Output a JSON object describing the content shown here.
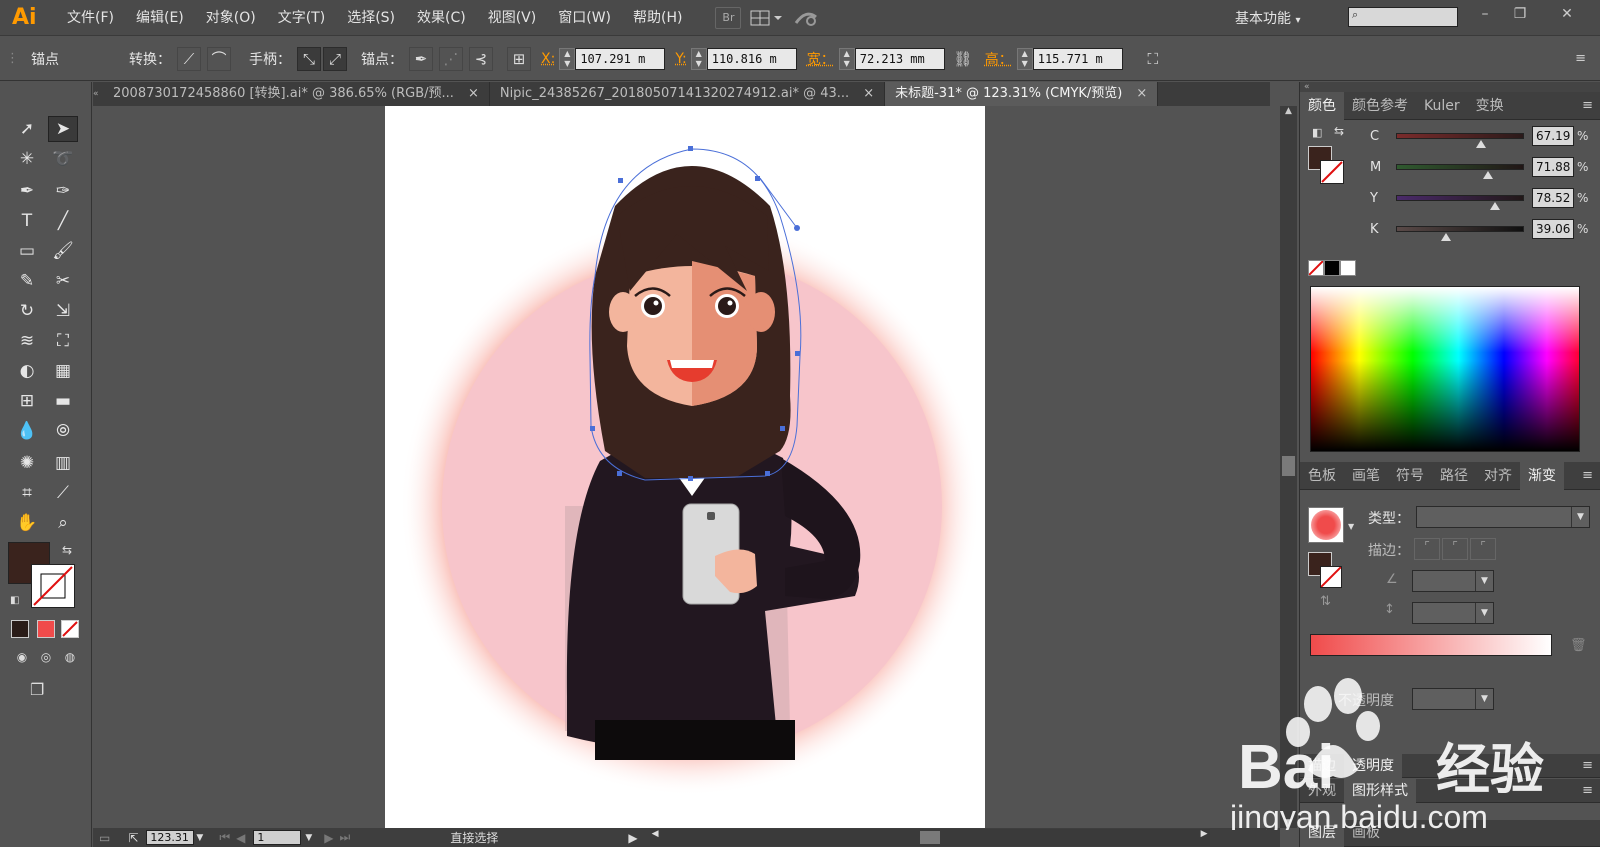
{
  "app": {
    "logo": "Ai"
  },
  "menu": [
    "文件(F)",
    "编辑(E)",
    "对象(O)",
    "文字(T)",
    "选择(S)",
    "效果(C)",
    "视图(V)",
    "窗口(W)",
    "帮助(H)"
  ],
  "appbar": {
    "bridge_label": "Br",
    "workspace": "基本功能",
    "workspace_arrow": "▾",
    "search_placeholder": ""
  },
  "control": {
    "tool_name": "锚点",
    "convert": "转换：",
    "handle": "手柄：",
    "anchor": "锚点：",
    "x_label": "X:",
    "x_value": "107.291 m",
    "y_label": "Y:",
    "y_value": "110.816 m",
    "w_label": "宽：",
    "w_value": "72.213 mm",
    "h_label": "高：",
    "h_value": "115.771 m"
  },
  "tabs": [
    {
      "label": "2008730172458860 [转换].ai* @ 386.65% (RGB/预...",
      "close": "×"
    },
    {
      "label": "Nipic_24385267_20180507141320274912.ai* @ 43...",
      "close": "×"
    },
    {
      "label": "未标题-31* @ 123.31% (CMYK/预览)",
      "close": "×"
    }
  ],
  "status": {
    "zoom": "123.31",
    "page": "1",
    "tool": "直接选择"
  },
  "color_panel": {
    "tabs": [
      "颜色",
      "颜色参考",
      "Kuler",
      "变换"
    ],
    "channels": [
      {
        "label": "C",
        "value": "67.19",
        "pos": 0.67,
        "colors": [
          "#7a2b2b",
          "#2a1a1a"
        ]
      },
      {
        "label": "M",
        "value": "71.88",
        "pos": 0.72,
        "colors": [
          "#2f5a2f",
          "#211616"
        ]
      },
      {
        "label": "Y",
        "value": "78.52",
        "pos": 0.78,
        "colors": [
          "#4a2a6a",
          "#221818"
        ]
      },
      {
        "label": "K",
        "value": "39.06",
        "pos": 0.39,
        "colors": [
          "#5a4a48",
          "#101010"
        ]
      }
    ],
    "unit": "%",
    "fill_color": "#3a231d"
  },
  "gradient_panel": {
    "tabs": [
      "色板",
      "画笔",
      "符号",
      "路径",
      "对齐",
      "渐变"
    ],
    "type_label": "类型：",
    "stroke_label": "描边：",
    "opacity_label": "不透明度",
    "gradient_from": "#f04b4b",
    "gradient_to": "#ffffff"
  },
  "bottom_tabs": {
    "row1": [
      "描边",
      "透明度"
    ],
    "row2": [
      "外观",
      "图形样式"
    ],
    "row3": [
      "图层",
      "画板"
    ]
  },
  "watermark": {
    "brand": "Bai",
    "brand2": "经验",
    "url": "jingyan.baidu.com"
  }
}
